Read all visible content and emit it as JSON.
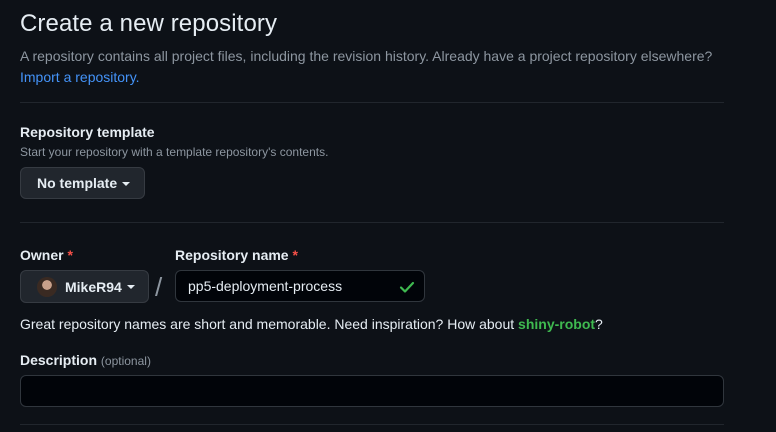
{
  "header": {
    "title": "Create a new repository",
    "subtitle": "A repository contains all project files, including the revision history. Already have a project repository elsewhere?",
    "import_link": "Import a repository."
  },
  "template": {
    "label": "Repository template",
    "hint": "Start your repository with a template repository's contents.",
    "button_label": "No template"
  },
  "owner": {
    "label": "Owner",
    "required_mark": "*",
    "value": "MikeR94"
  },
  "separator": "/",
  "repo_name": {
    "label": "Repository name",
    "required_mark": "*",
    "value": "pp5-deployment-process",
    "valid": true
  },
  "name_hint": {
    "text": "Great repository names are short and memorable. Need inspiration? How about ",
    "suggestion": "shiny-robot",
    "end": "?"
  },
  "description": {
    "label": "Description",
    "optional": "(optional)",
    "value": ""
  },
  "colors": {
    "background": "#0d1117",
    "link": "#4493f8",
    "success": "#3fb950",
    "required": "#f85149"
  },
  "icons": {
    "owner_caret": "caret-down-icon",
    "template_caret": "caret-down-icon",
    "valid_check": "check-icon"
  }
}
